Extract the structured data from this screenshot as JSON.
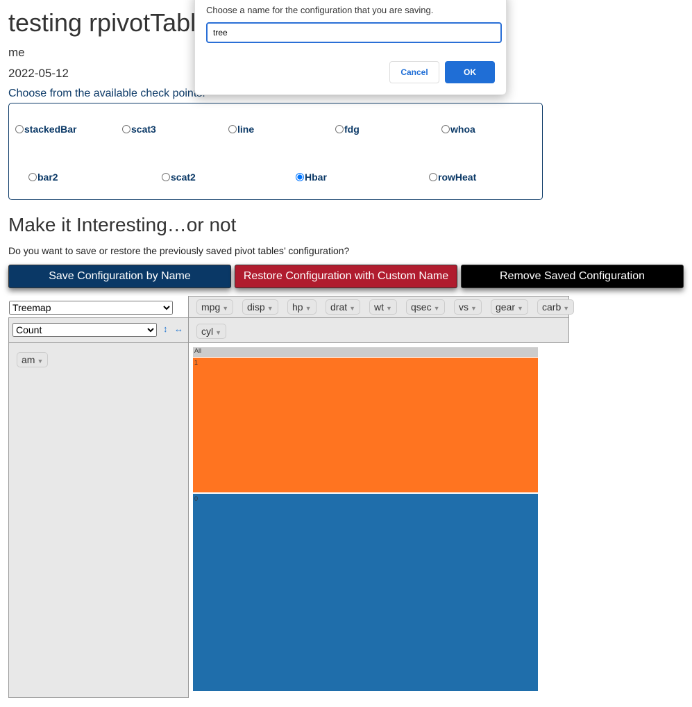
{
  "title": "testing rpivotTable",
  "author": "me",
  "date": "2022-05-12",
  "checkpoint_prompt": "Choose from the available check points:",
  "checkpoints": [
    {
      "label": "stackedBar",
      "checked": false
    },
    {
      "label": "scat3",
      "checked": false
    },
    {
      "label": "line",
      "checked": false
    },
    {
      "label": "fdg",
      "checked": false
    },
    {
      "label": "whoa",
      "checked": false
    },
    {
      "label": "bar2",
      "checked": false
    },
    {
      "label": "scat2",
      "checked": false
    },
    {
      "label": "Hbar",
      "checked": true
    },
    {
      "label": "rowHeat",
      "checked": false
    }
  ],
  "section_title": "Make it Interesting…or not",
  "section_prompt": "Do you want to save or restore the previously saved pivot tables’ configuration?",
  "buttons": {
    "save": "Save Configuration by Name",
    "restore": "Restore Configuration with Custom Name",
    "remove": "Remove Saved Configuration"
  },
  "colors": {
    "save": "#0a3866",
    "restore": "#b01c2e",
    "remove": "#000000",
    "treemap_1": "#ff7420",
    "treemap_0": "#1f6eab"
  },
  "pivot": {
    "renderer": "Treemap",
    "aggregator": "Count",
    "sort_row_icon": "↕",
    "sort_col_icon": "↔",
    "unused_attrs": [
      "mpg",
      "disp",
      "hp",
      "drat",
      "wt",
      "qsec",
      "vs",
      "gear",
      "carb"
    ],
    "col_attrs": [
      "cyl"
    ],
    "row_attrs": [
      "am"
    ]
  },
  "chart_data": {
    "type": "treemap",
    "root": "All",
    "categories": [
      "1",
      "0"
    ],
    "values": [
      13,
      19
    ]
  },
  "dialog": {
    "message": "Choose a name for the configuration that you are saving.",
    "input_value": "tree",
    "cancel": "Cancel",
    "ok": "OK"
  }
}
